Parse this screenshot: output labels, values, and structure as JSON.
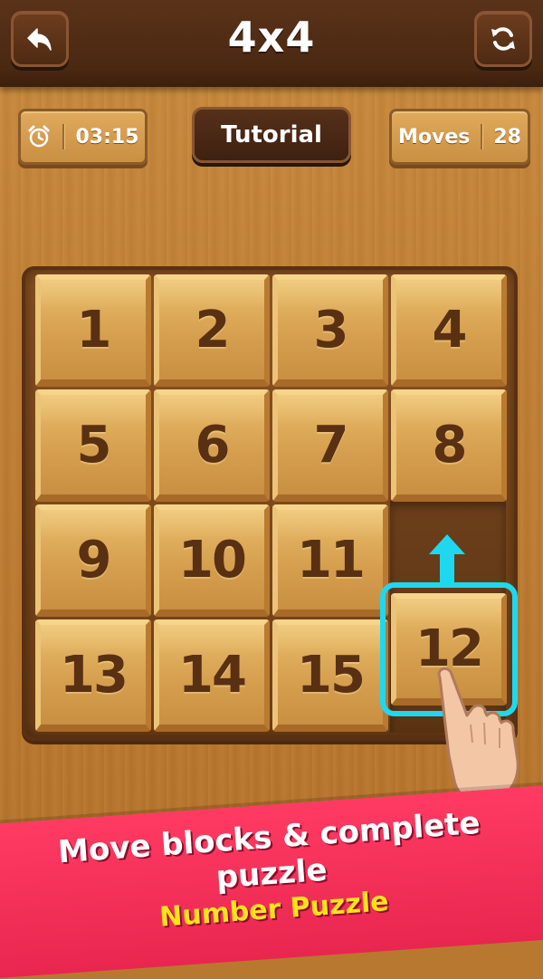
{
  "header": {
    "title": "4x4",
    "back_icon": "back-arrow-icon",
    "restart_icon": "restart-icon"
  },
  "status": {
    "timer_icon": "alarm-clock-icon",
    "timer": "03:15",
    "tutorial_label": "Tutorial",
    "moves_label": "Moves",
    "moves_value": "28"
  },
  "board": {
    "size": "4x4",
    "tiles": [
      "1",
      "2",
      "3",
      "4",
      "5",
      "6",
      "7",
      "8",
      "9",
      "10",
      "11",
      "",
      "13",
      "14",
      "15",
      "12"
    ],
    "highlighted_tile": "12",
    "hint": "arrow-up-icon"
  },
  "banner": {
    "line1": "Move blocks & complete puzzle",
    "line2": "Number Puzzle"
  },
  "colors": {
    "wood_dark": "#4a2812",
    "tile_face": "#d6a04f",
    "number": "#5a3012",
    "highlight": "#1fd8ef",
    "banner": "#e8264f",
    "banner_accent": "#ffe21a"
  }
}
